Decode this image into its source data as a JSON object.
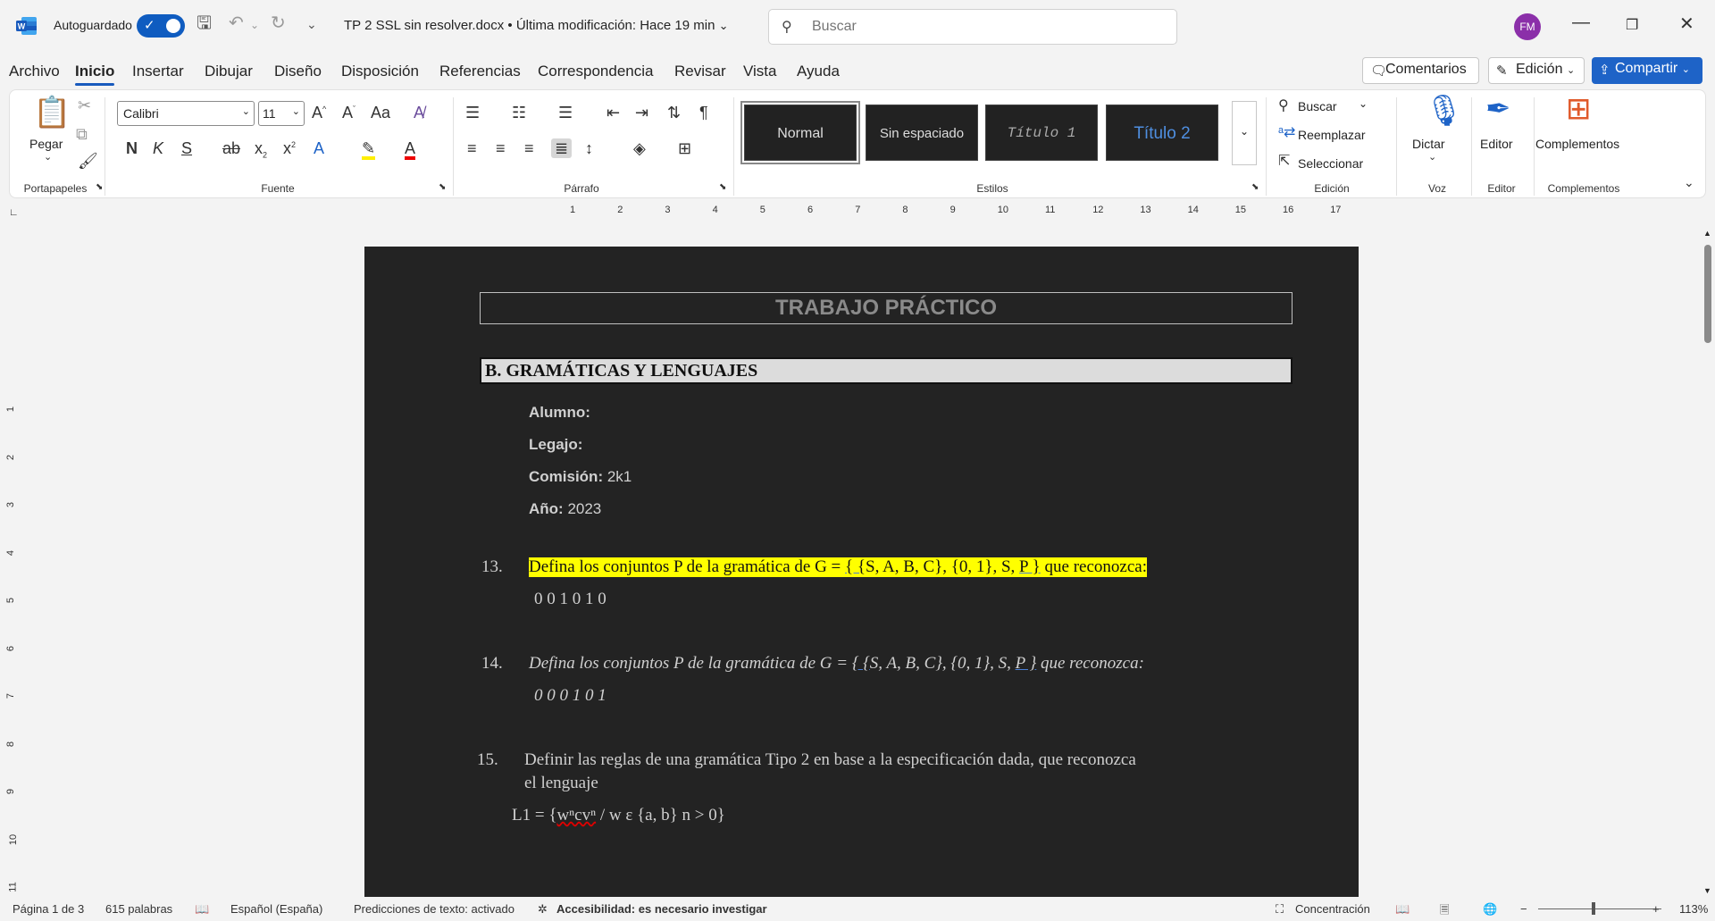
{
  "titlebar": {
    "autosave_label": "Autoguardado",
    "doc_title": "TP 2 SSL sin resolver.docx • Última modificación: Hace 19 min",
    "search_placeholder": "Buscar",
    "avatar_initials": "FM"
  },
  "menu": {
    "tabs": [
      "Archivo",
      "Inicio",
      "Insertar",
      "Dibujar",
      "Diseño",
      "Disposición",
      "Referencias",
      "Correspondencia",
      "Revisar",
      "Vista",
      "Ayuda"
    ],
    "active_tab": "Inicio",
    "comments_label": "Comentarios",
    "edit_mode_label": "Edición",
    "share_label": "Compartir"
  },
  "ribbon": {
    "paste_label": "Pegar",
    "font_name": "Calibri",
    "font_size": "11",
    "styles": [
      "Normal",
      "Sin espaciado",
      "Título 1",
      "Título 2"
    ],
    "find_label": "Buscar",
    "replace_label": "Reemplazar",
    "select_label": "Seleccionar",
    "dictate_label": "Dictar",
    "editor_label": "Editor",
    "addins_label": "Complementos",
    "groups": {
      "clipboard": "Portapapeles",
      "font": "Fuente",
      "paragraph": "Párrafo",
      "styles": "Estilos",
      "editing": "Edición",
      "voice": "Voz",
      "editor": "Editor",
      "addins": "Complementos"
    }
  },
  "ruler": {
    "h_numbers": [
      "1",
      "2",
      "3",
      "4",
      "5",
      "6",
      "7",
      "8",
      "9",
      "10",
      "11",
      "12",
      "13",
      "14",
      "15",
      "16",
      "17"
    ],
    "v_numbers": [
      "1",
      "2",
      "3",
      "4",
      "5",
      "6",
      "7",
      "8",
      "9",
      "10",
      "11"
    ]
  },
  "document": {
    "title": "TRABAJO PRÁCTICO",
    "section": "B. GRAMÁTICAS Y LENGUAJES",
    "fields": [
      {
        "label": "Alumno:",
        "value": ""
      },
      {
        "label": "Legajo:",
        "value": ""
      },
      {
        "label": "Comisión:",
        "value": " 2k1"
      },
      {
        "label": "Año:",
        "value": " 2023"
      }
    ],
    "items": [
      {
        "num": "13.",
        "text_a": "Defina los conjuntos P de la gramática de G = ",
        "u1": "{ {",
        "text_b": "S, A, B, C}, {0, 1}, S, ",
        "u2": "P }",
        "text_c": " que reconozca:",
        "sub": "0 0 1 0 1 0"
      },
      {
        "num": "14.",
        "text_a": "Defina los conjuntos P de la gramática de G = ",
        "u1": "{ {",
        "text_b": "S, A, B, C}, {0, 1}, S, ",
        "u2": "P }",
        "text_c": " que reconozca:",
        "sub": "0 0 0 1 0 1"
      },
      {
        "num": "15.",
        "line1": "Definir las reglas de una gramática Tipo 2 en base a la especificación dada, que reconozca",
        "line2": "el lenguaje",
        "lang_a": "L1 = {",
        "lang_sq": "wⁿcvⁿ",
        "lang_b": " / w ε {a, b} n > 0}"
      }
    ]
  },
  "status": {
    "page": "Página 1 de 3",
    "words": "615 palabras",
    "language": "Español (España)",
    "predictions": "Predicciones de texto: activado",
    "accessibility": "Accesibilidad: es necesario investigar",
    "focus": "Concentración",
    "zoom": "113%"
  }
}
